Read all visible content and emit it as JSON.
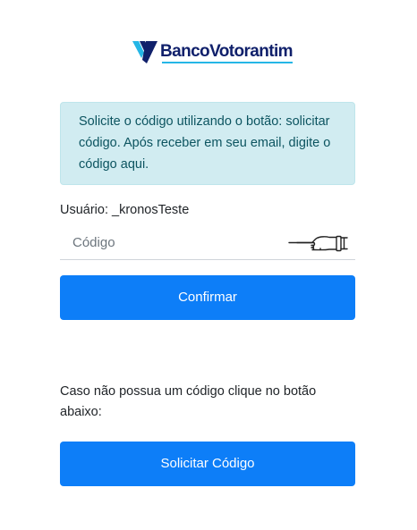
{
  "brand": {
    "name": "BancoVotorantim",
    "logo_icon": "bv-logo-icon",
    "primary_color": "#10206b",
    "accent_color": "#25b6e6"
  },
  "alert": {
    "message": "Solicite o código utilizando o botão: solicitar código. Após receber em seu email, digite o código aqui.",
    "background_color": "#d1ecf1",
    "text_color": "#0c5460"
  },
  "user": {
    "label": "Usuário: _kronosTeste"
  },
  "code_input": {
    "value": "",
    "placeholder": "Código",
    "icon": "pointing-hand-icon"
  },
  "buttons": {
    "confirm_label": "Confirmar",
    "request_label": "Solicitar Código",
    "color": "#0d7ef8"
  },
  "hint": {
    "text": "Caso não possua um código clique no botão abaixo:"
  }
}
